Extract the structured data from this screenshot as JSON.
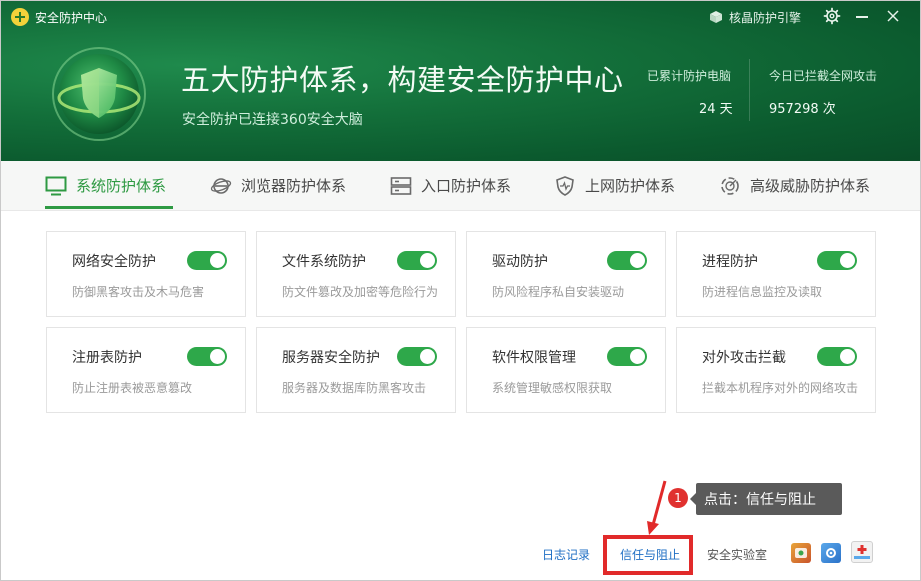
{
  "window": {
    "title": "安全防护中心",
    "engine_label": "核晶防护引擎"
  },
  "header": {
    "headline": "五大防护体系，构建安全防护中心",
    "subline": "安全防护已连接360安全大脑",
    "stats": [
      {
        "label": "已累计防护电脑",
        "value": "24 天"
      },
      {
        "label": "今日已拦截全网攻击",
        "value": "957298 次"
      }
    ]
  },
  "tabs": [
    {
      "label": "系统防护体系",
      "icon": "monitor-icon",
      "active": true
    },
    {
      "label": "浏览器防护体系",
      "icon": "browser-icon",
      "active": false
    },
    {
      "label": "入口防护体系",
      "icon": "server-icon",
      "active": false
    },
    {
      "label": "上网防护体系",
      "icon": "shield-pulse-icon",
      "active": false
    },
    {
      "label": "高级威胁防护体系",
      "icon": "radar-icon",
      "active": false
    }
  ],
  "cards": [
    {
      "title": "网络安全防护",
      "desc": "防御黑客攻击及木马危害",
      "enabled": true
    },
    {
      "title": "文件系统防护",
      "desc": "防文件篡改及加密等危险行为",
      "enabled": true
    },
    {
      "title": "驱动防护",
      "desc": "防风险程序私自安装驱动",
      "enabled": true
    },
    {
      "title": "进程防护",
      "desc": "防进程信息监控及读取",
      "enabled": true
    },
    {
      "title": "注册表防护",
      "desc": "防止注册表被恶意篡改",
      "enabled": true
    },
    {
      "title": "服务器安全防护",
      "desc": "服务器及数据库防黑客攻击",
      "enabled": true
    },
    {
      "title": "软件权限管理",
      "desc": "系统管理敏感权限获取",
      "enabled": true
    },
    {
      "title": "对外攻击拦截",
      "desc": "拦截本机程序对外的网络攻击",
      "enabled": true
    }
  ],
  "footer": {
    "log_link": "日志记录",
    "trust_link": "信任与阻止",
    "lab_link": "安全实验室"
  },
  "annotation": {
    "step": "1",
    "tip": "点击：信任与阻止"
  },
  "colors": {
    "header_green": "#136f3a",
    "accent_green": "#2e9a43",
    "toggle_green": "#2ea84a",
    "link_blue": "#1f6fc4",
    "highlight_red": "#e12a2a"
  }
}
